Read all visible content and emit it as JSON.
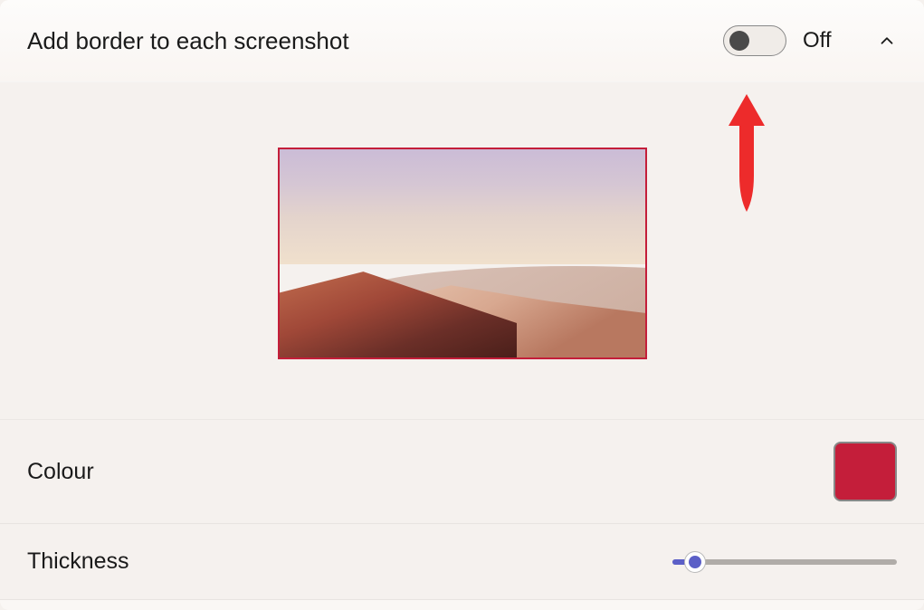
{
  "header": {
    "title": "Add border to each screenshot",
    "toggle_state": "Off"
  },
  "border": {
    "colour_label": "Colour",
    "colour_value": "#c41e3a",
    "thickness_label": "Thickness",
    "thickness_percent": 10
  }
}
